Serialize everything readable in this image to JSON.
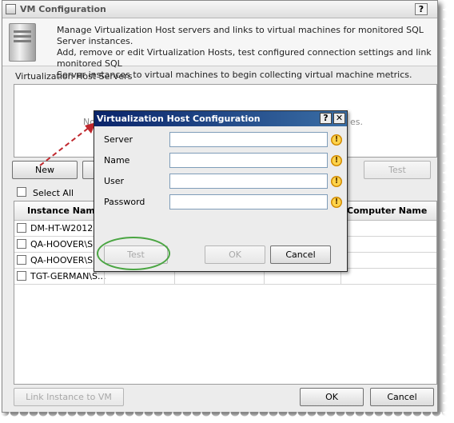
{
  "window": {
    "title": "VM Configuration",
    "help_label": "?",
    "description": "Manage Virtualization Host servers and links to virtual machines for monitored SQL Server instances.\nAdd, remove or edit Virtualization Hosts, test configured connection settings and link monitored SQL\nServer instances to virtual machines to begin collecting virtual machine metrics."
  },
  "hosts": {
    "section_label": "Virtualization Host Servers",
    "empty_prefix": "No",
    "empty_suffix": "es.",
    "buttons": {
      "new": "New",
      "test": "Test"
    }
  },
  "instances": {
    "select_all_label": "Select All",
    "columns": [
      "Instance Name",
      "Computer Name"
    ],
    "rows": [
      "DM-HT-W2012R",
      "QA-HOOVER\\S...",
      "QA-HOOVER\\S...",
      "TGT-GERMAN\\S..."
    ]
  },
  "bottom": {
    "link_label": "Link Instance to VM",
    "ok_label": "OK",
    "cancel_label": "Cancel"
  },
  "dialog": {
    "title": "Virtualization Host Configuration",
    "help_label": "?",
    "close_label": "✕",
    "fields": [
      {
        "label": "Server",
        "value": ""
      },
      {
        "label": "Name",
        "value": ""
      },
      {
        "label": "User",
        "value": ""
      },
      {
        "label": "Password",
        "value": ""
      }
    ],
    "warning_glyph": "!",
    "buttons": {
      "test": "Test",
      "ok": "OK",
      "cancel": "Cancel"
    }
  },
  "colors": {
    "dialog_title_start": "#0a246a",
    "dialog_title_end": "#3a6ea5",
    "highlight_oval": "#4aa542",
    "arrow": "#c0272d"
  }
}
